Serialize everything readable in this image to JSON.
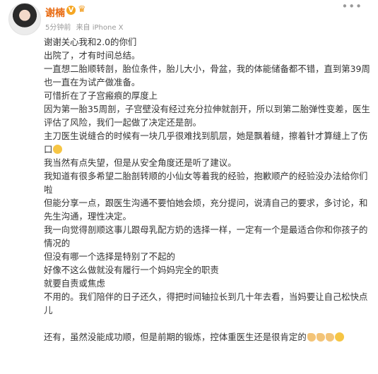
{
  "post": {
    "author": "谢楠",
    "verified_badge": "V",
    "time": "5分钟前",
    "source": "来自 iPhone X",
    "more": "•••"
  },
  "content": {
    "lines": [
      "谢谢关心我和2.0的你们",
      "出院了，才有时间总结。",
      "一直想二胎顺转剖，胎位条件，胎儿大小，骨盆，我的体能储备都不错，直到第39周也一直在为试产做准备。",
      "可惜折在了子宫瘢痕的厚度上",
      "因为第一胎35周剖，子宫壁没有经过充分拉伸就剖开，所以到第二胎弹性变差，医生评估了风险，我们一起做了决定还是剖。",
      "主刀医生说缝合的时候有一块几乎很难找到肌层，她是飘着缝，擦着针才算缝上了伤口",
      "我当然有点失望，但是从安全角度还是听了建议。",
      "我知道有很多希望二胎剖转顺的小仙女等着我的经验，抱歉顺产的经验没办法给你们啦",
      "但能分享一点，跟医生沟通不要怕她会烦，充分提问，说清自己的要求，多讨论，和先生沟通，理性决定。",
      "我一向觉得剖顺这事儿跟母乳配方奶的选择一样，一定有一个是最适合你和你孩子的情况的",
      "但没有哪一个选择是特别了不起的",
      "好像不这么做就没有履行一个妈妈完全的职责",
      "就要自责或焦虑",
      "不用的。我们陪伴的日子还久，得把时间轴拉长到几十年去看，当妈要让自己松快点儿",
      "还有，虽然没能成功顺，但是前期的锻炼，控体重医生还是很肯定的"
    ]
  }
}
